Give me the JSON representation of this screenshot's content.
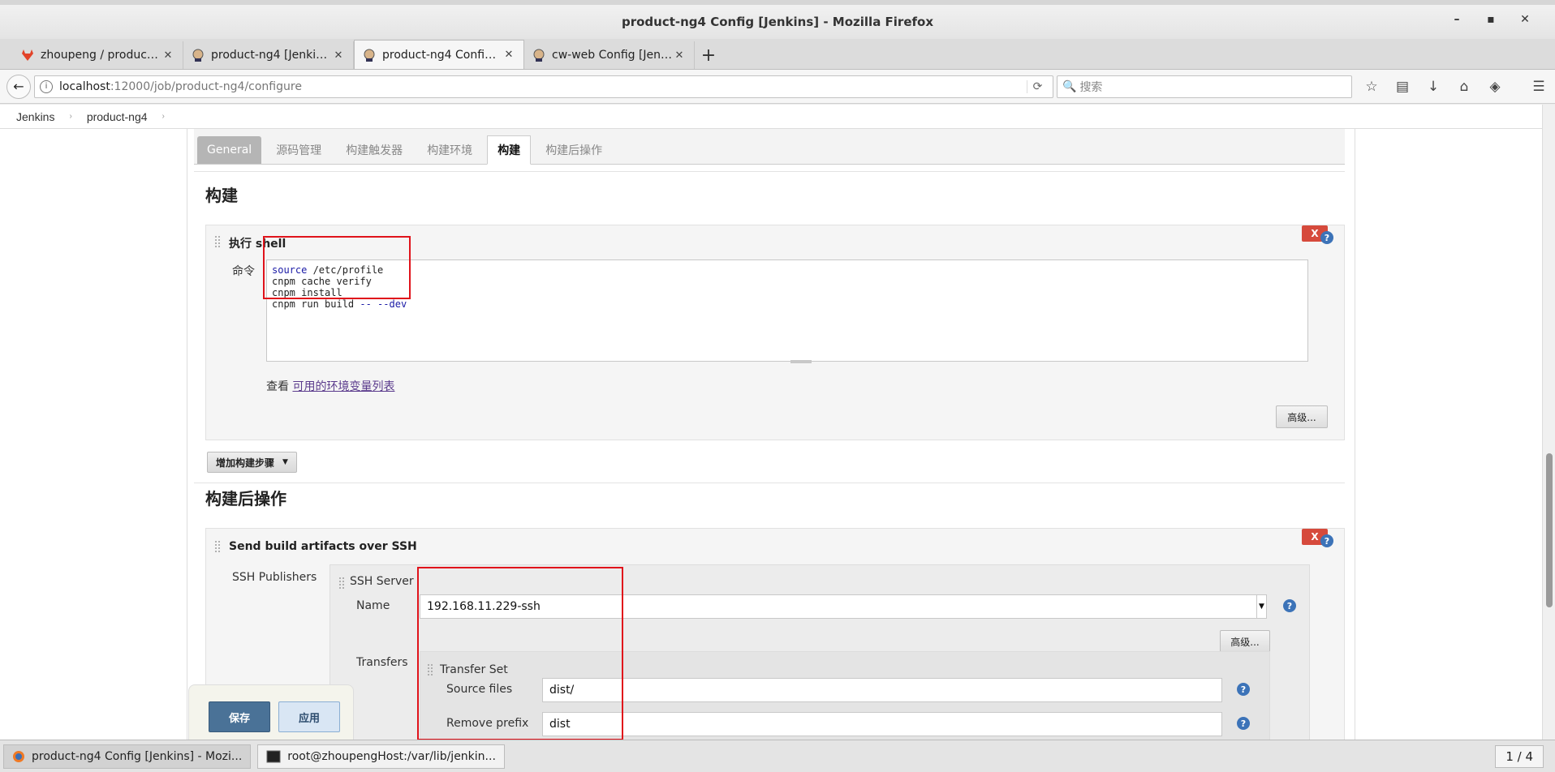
{
  "window": {
    "title": "product-ng4 Config [Jenkins] - Mozilla Firefox",
    "controls": [
      "–",
      "▪",
      "✕"
    ]
  },
  "browser_tabs": [
    {
      "label": "zhoupeng / product-n...",
      "icon": "gitlab-icon",
      "active": false
    },
    {
      "label": "product-ng4 [Jenkins]",
      "icon": "jenkins-icon",
      "active": false
    },
    {
      "label": "product-ng4 Config [J...",
      "icon": "jenkins-icon",
      "active": true
    },
    {
      "label": "cw-web Config [Jenki...",
      "icon": "jenkins-icon",
      "active": false
    }
  ],
  "navbar": {
    "url_host": "localhost",
    "url_rest": ":12000/job/product-ng4/configure",
    "search_placeholder": "搜索"
  },
  "breadcrumbs": [
    "Jenkins",
    "product-ng4"
  ],
  "config_tabs": [
    "General",
    "源码管理",
    "构建触发器",
    "构建环境",
    "构建",
    "构建后操作"
  ],
  "build": {
    "section_title": "构建",
    "step_title": "执行 shell",
    "delete_label": "X",
    "command_label": "命令",
    "command_lines": [
      {
        "kw": "source",
        "rest": " /etc/profile"
      },
      {
        "kw": "",
        "rest": "cnpm cache verify"
      },
      {
        "kw": "",
        "rest": "cnpm install"
      },
      {
        "kw": "",
        "rest": "cnpm run build ",
        "kw2": "-- --dev"
      }
    ],
    "env_prefix": "查看 ",
    "env_link": "可用的环境变量列表",
    "advanced_label": "高级...",
    "add_step_label": "增加构建步骤"
  },
  "post_build": {
    "section_title": "构建后操作",
    "step_title": "Send build artifacts over SSH",
    "delete_label": "X",
    "ssh_publishers_label": "SSH Publishers",
    "ssh_server_label": "SSH Server",
    "name_label": "Name",
    "name_value": "192.168.11.229-ssh",
    "advanced_label": "高级...",
    "transfers_label": "Transfers",
    "transfer_set_label": "Transfer Set",
    "source_files_label": "Source files",
    "source_files_value": "dist/",
    "remove_prefix_label": "Remove prefix",
    "remove_prefix_value": "dist"
  },
  "savebar": {
    "save_label": "保存",
    "apply_label": "应用"
  },
  "taskbar": {
    "items": [
      {
        "label": "product-ng4 Config [Jenkins] - Mozi...",
        "icon": "firefox-icon"
      },
      {
        "label": "root@zhoupengHost:/var/lib/jenkin...",
        "icon": "terminal-icon"
      }
    ],
    "pager": "1 / 4"
  },
  "colors": {
    "accent_red": "#e0131b",
    "delete_red": "#d64a3c",
    "save_blue": "#4a7297",
    "help_blue": "#3c73b8"
  }
}
